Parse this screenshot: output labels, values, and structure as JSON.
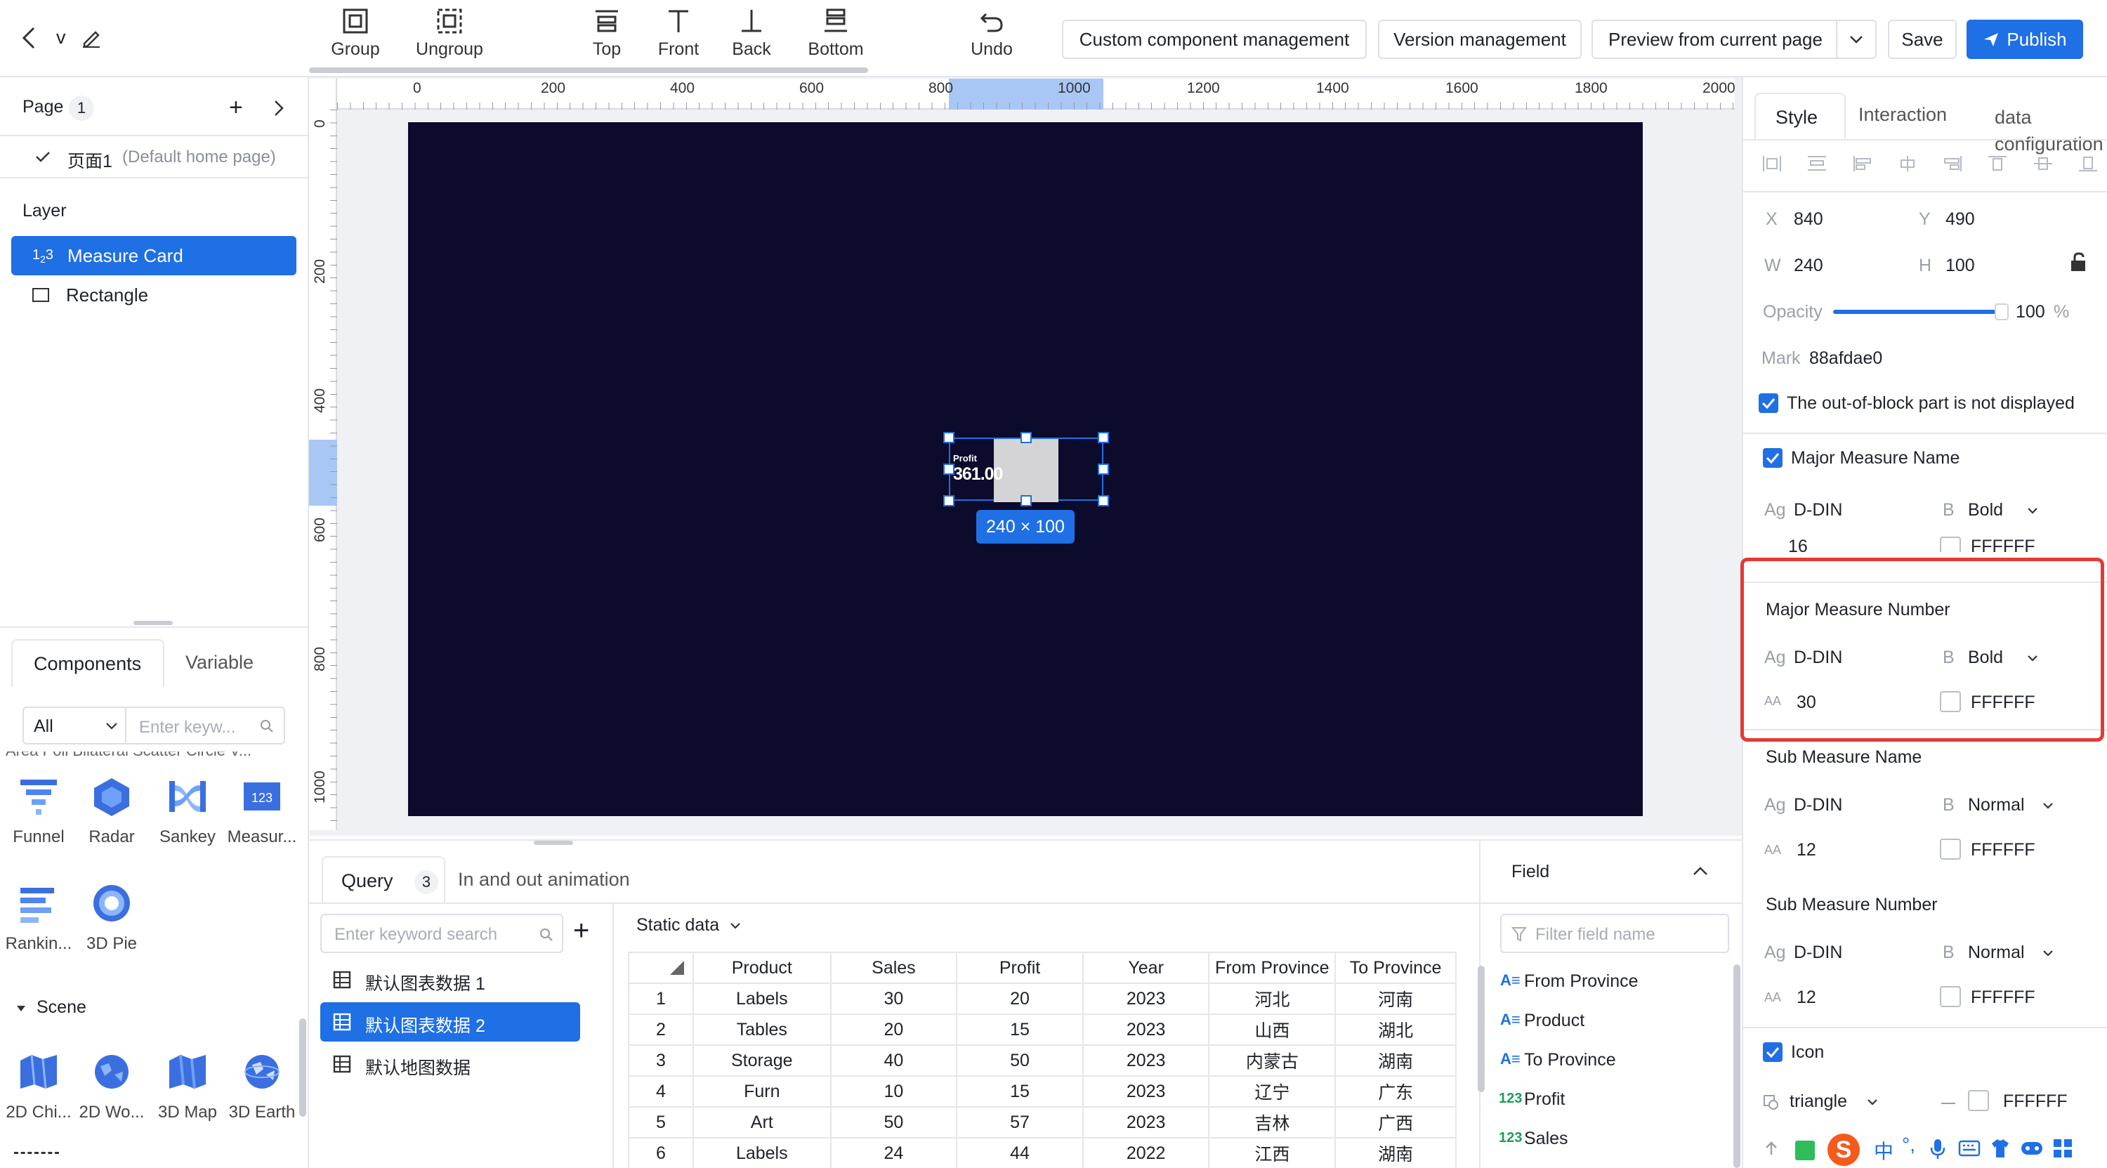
{
  "header": {
    "title": "v",
    "toolbar": [
      {
        "label": "Group",
        "icon": "group-icon"
      },
      {
        "label": "Ungroup",
        "icon": "ungroup-icon"
      },
      {
        "label": "Top",
        "icon": "bring-top-icon"
      },
      {
        "label": "Front",
        "icon": "bring-front-icon"
      },
      {
        "label": "Back",
        "icon": "send-back-icon"
      },
      {
        "label": "Bottom",
        "icon": "send-bottom-icon"
      },
      {
        "label": "Undo",
        "icon": "undo-icon"
      }
    ],
    "buttons": {
      "custom": "Custom component management",
      "version": "Version management",
      "preview": "Preview from current page",
      "save": "Save",
      "publish": "Publish"
    },
    "accent": "#1f6fe5"
  },
  "left": {
    "page_label": "Page",
    "page_count": "1",
    "page_item": "页面1",
    "page_item_note": "(Default home page)",
    "layer_label": "Layer",
    "layers": [
      {
        "label": "Measure Card",
        "icon": "number-icon"
      },
      {
        "label": "Rectangle",
        "icon": "rectangle-icon"
      }
    ],
    "tabs": {
      "components": "Components",
      "variable": "Variable"
    },
    "filter_value": "All",
    "search_placeholder": "Enter keyw...",
    "clipped_row": "Area Poll Bilateral Scatter Circle V...",
    "components": [
      "Funnel",
      "Radar",
      "Sankey",
      "Measur...",
      "Rankin...",
      "3D Pie"
    ],
    "scene_label": "Scene",
    "scene_items": [
      "2D Chi...",
      "2D Wo...",
      "3D Map",
      "3D Earth"
    ]
  },
  "ruler": {
    "top_ticks": [
      "0",
      "200",
      "400",
      "600",
      "800",
      "1000",
      "1200",
      "1400",
      "1600",
      "1800",
      "2000"
    ],
    "left_ticks": [
      "0",
      "200",
      "400",
      "600",
      "800",
      "1000"
    ]
  },
  "canvas": {
    "background": "#0c0b2b",
    "card_name": "Profit",
    "card_value": "361.00",
    "size_badge": "240 × 100"
  },
  "bottom": {
    "tabs": {
      "query": "Query",
      "query_count": "3",
      "animation": "In and out animation"
    },
    "search_placeholder": "Enter keyword search",
    "datasets": [
      "默认图表数据 1",
      "默认图表数据 2",
      "默认地图数据"
    ],
    "active_dataset": 1,
    "static_label": "Static data",
    "columns": [
      "Product",
      "Sales",
      "Profit",
      "Year",
      "From Province",
      "To Province"
    ],
    "rows": [
      [
        "1",
        "Labels",
        "30",
        "20",
        "2023",
        "河北",
        "河南"
      ],
      [
        "2",
        "Tables",
        "20",
        "15",
        "2023",
        "山西",
        "湖北"
      ],
      [
        "3",
        "Storage",
        "40",
        "50",
        "2023",
        "内蒙古",
        "湖南"
      ],
      [
        "4",
        "Furn",
        "10",
        "15",
        "2023",
        "辽宁",
        "广东"
      ],
      [
        "5",
        "Art",
        "50",
        "57",
        "2023",
        "吉林",
        "广西"
      ],
      [
        "6",
        "Labels",
        "24",
        "44",
        "2022",
        "江西",
        "湖南"
      ]
    ],
    "field_title": "Field",
    "field_placeholder": "Filter field name",
    "fields": [
      {
        "label": "From Province",
        "type": "text"
      },
      {
        "label": "Product",
        "type": "text"
      },
      {
        "label": "To Province",
        "type": "text"
      },
      {
        "label": "Profit",
        "type": "number"
      },
      {
        "label": "Sales",
        "type": "number"
      }
    ]
  },
  "right": {
    "tabs": {
      "style": "Style",
      "interaction": "Interaction",
      "data": "data configuration"
    },
    "x_label": "X",
    "x_value": "840",
    "y_label": "Y",
    "y_value": "490",
    "w_label": "W",
    "w_value": "240",
    "h_label": "H",
    "h_value": "100",
    "opacity_label": "Opacity",
    "opacity_value": "100",
    "opacity_unit": "%",
    "opacity_fraction": 1.0,
    "mark_label": "Mark",
    "mark_value": "88afdae0",
    "overflow_label": "The out-of-block part is not displayed",
    "major_name": {
      "title": "Major Measure Name",
      "font": "D-DIN",
      "weight": "Bold",
      "size": "16",
      "color": "FFFFFF"
    },
    "major_number": {
      "title": "Major Measure Number",
      "font": "D-DIN",
      "weight": "Bold",
      "size": "30",
      "color": "FFFFFF"
    },
    "sub_name": {
      "title": "Sub Measure Name",
      "font": "D-DIN",
      "weight": "Normal",
      "size": "12",
      "color": "FFFFFF"
    },
    "sub_number": {
      "title": "Sub Measure Number",
      "font": "D-DIN",
      "weight": "Normal",
      "size": "12",
      "color": "FFFFFF"
    },
    "icon_label": "Icon",
    "icon_shape": "triangle",
    "icon_color": "FFFFFF",
    "highlight_color": "#e53935"
  },
  "taskbar": {
    "ime": "中"
  }
}
